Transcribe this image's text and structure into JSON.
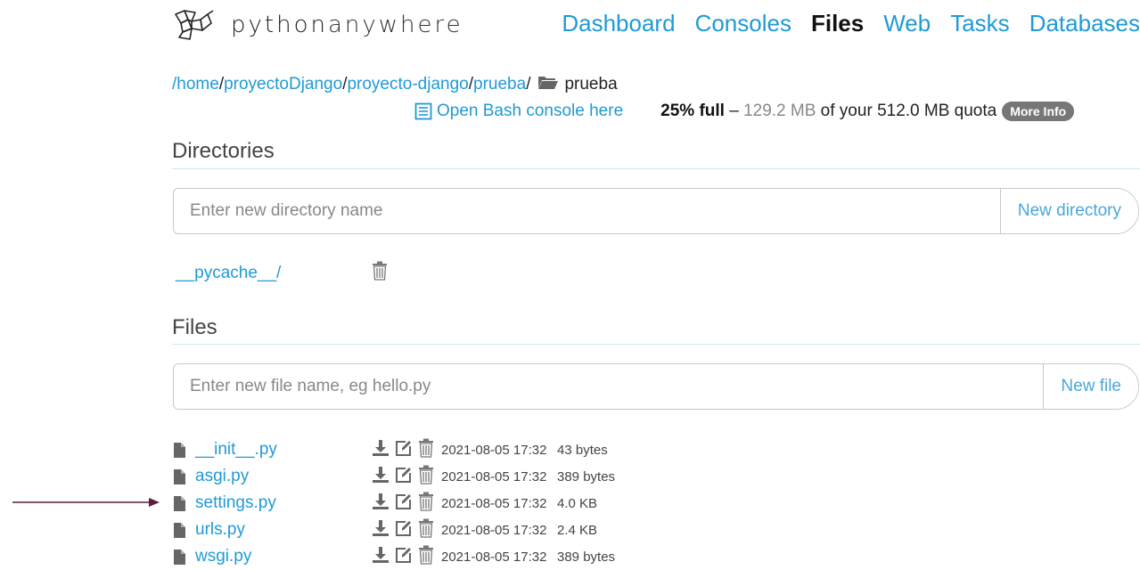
{
  "brand": {
    "name_part1": "python",
    "name_part2": "anywhere"
  },
  "nav": [
    "Dashboard",
    "Consoles",
    "Files",
    "Web",
    "Tasks",
    "Databases"
  ],
  "nav_active": "Files",
  "breadcrumb": {
    "parts": [
      "/home",
      "/",
      "proyectoDjango",
      "/",
      "proyecto-django",
      "/",
      "prueba",
      "/"
    ],
    "current": "prueba"
  },
  "bash_link": "Open Bash console here",
  "quota": {
    "percent": "25% full",
    "dash": " – ",
    "used": "129.2 MB",
    "of": " of your ",
    "total": "512.0 MB quota",
    "more_info": "More Info"
  },
  "directories": {
    "title": "Directories",
    "placeholder": "Enter new directory name",
    "button": "New directory",
    "items": [
      "__pycache__/"
    ]
  },
  "files": {
    "title": "Files",
    "placeholder": "Enter new file name, eg hello.py",
    "button": "New file",
    "items": [
      {
        "name": "__init__.py",
        "date": "2021-08-05 17:32",
        "size": "43 bytes"
      },
      {
        "name": "asgi.py",
        "date": "2021-08-05 17:32",
        "size": "389 bytes"
      },
      {
        "name": "settings.py",
        "date": "2021-08-05 17:32",
        "size": "4.0 KB"
      },
      {
        "name": "urls.py",
        "date": "2021-08-05 17:32",
        "size": "2.4 KB"
      },
      {
        "name": "wsgi.py",
        "date": "2021-08-05 17:32",
        "size": "389 bytes"
      }
    ]
  },
  "colors": {
    "link": "#1f9ad6",
    "badge": "#777777",
    "arrow": "#5a1f3d"
  }
}
